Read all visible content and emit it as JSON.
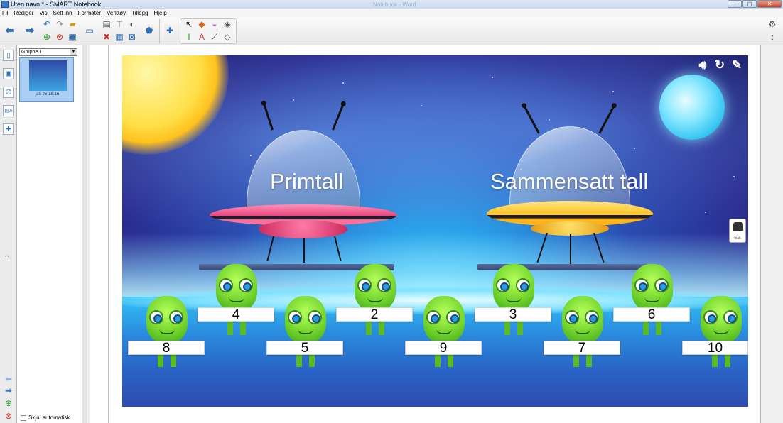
{
  "window": {
    "title": "Uten navn * - SMART Notebook",
    "ghost_title": "Notebook - Word",
    "buttons": [
      "–",
      "▢",
      "✕"
    ]
  },
  "menu": [
    "Fil",
    "Rediger",
    "Vis",
    "Sett inn",
    "Formater",
    "Verktøy",
    "Tillegg",
    "Hjelp"
  ],
  "sorter": {
    "group": "Gruppe 1",
    "thumb_caption": "jan 26-18:16",
    "autohide_label": "Skjul automatisk"
  },
  "scene": {
    "ufo_left_label": "Primtall",
    "ufo_right_label": "Sammensatt tall",
    "numbers_top": [
      "4",
      "2",
      "3",
      "6"
    ],
    "numbers_bottom": [
      "8",
      "5",
      "9",
      "7",
      "10"
    ],
    "sun_color": "#ffd23a",
    "ufo_left_color": "#e8457a",
    "ufo_right_color": "#ffc21e"
  },
  "icons": {
    "sound": "speaker-icon",
    "reset": "reset-icon",
    "pen": "pen-icon"
  },
  "right_tab": {
    "label": "fokk"
  }
}
